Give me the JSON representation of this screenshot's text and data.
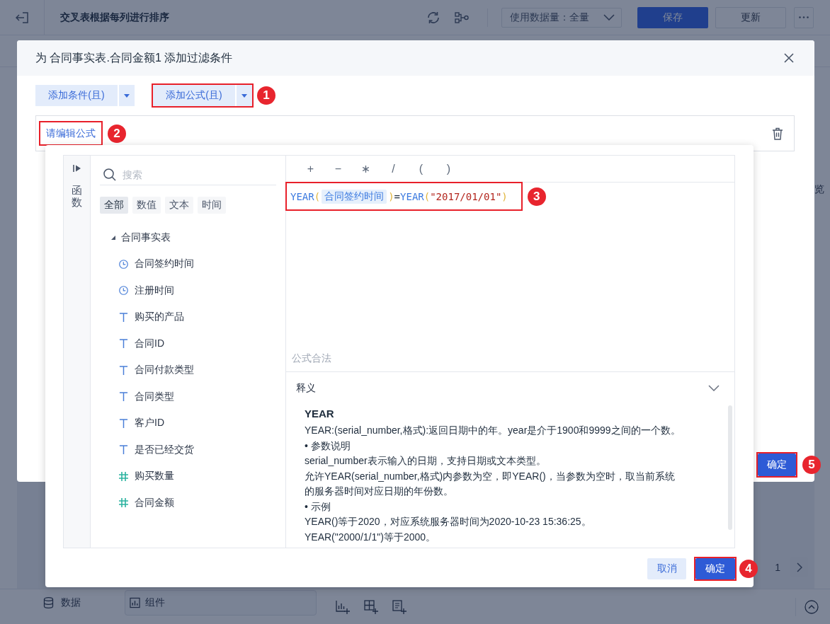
{
  "app": {
    "title": "交叉表根据每列进行排序",
    "data_mode": "使用数据量：全量",
    "actions": [
      {
        "label": "保存",
        "kind": "primary"
      },
      {
        "label": "更新",
        "kind": "default"
      }
    ],
    "side_label": "览",
    "pager": {
      "page": "1"
    },
    "bottom_tabs": [
      {
        "label": "数据",
        "selected": false
      },
      {
        "label": "组件",
        "selected": true
      }
    ]
  },
  "dialog": {
    "title": "为 合同事实表.合同金额1 添加过滤条件",
    "add_buttons": [
      {
        "label": "添加条件(且)"
      },
      {
        "label": "添加公式(且)",
        "callout": "1"
      }
    ],
    "condition": {
      "link": "请编辑公式",
      "callout": "2"
    },
    "confirm": {
      "label": "确定",
      "callout": "5"
    }
  },
  "formula_editor": {
    "rail_label": "函数",
    "search": {
      "placeholder": "搜索"
    },
    "filters": [
      {
        "label": "全部",
        "selected": true
      },
      {
        "label": "数值",
        "selected": false
      },
      {
        "label": "文本",
        "selected": false
      },
      {
        "label": "时间",
        "selected": false
      }
    ],
    "tree": [
      {
        "label": "合同事实表",
        "expanded": true,
        "children": [
          {
            "label": "合同签约时间",
            "kind": "date"
          },
          {
            "label": "注册时间",
            "kind": "date"
          },
          {
            "label": "购买的产品",
            "kind": "text"
          },
          {
            "label": "合同ID",
            "kind": "text"
          },
          {
            "label": "合同付款类型",
            "kind": "text"
          },
          {
            "label": "合同类型",
            "kind": "text"
          },
          {
            "label": "客户ID",
            "kind": "text"
          },
          {
            "label": "是否已经交货",
            "kind": "text"
          },
          {
            "label": "购买数量",
            "kind": "number"
          },
          {
            "label": "合同金额",
            "kind": "number"
          }
        ]
      }
    ],
    "operators": [
      "+",
      "−",
      "∗",
      "/",
      "(",
      ")"
    ],
    "formula": {
      "callout": "3",
      "tokens": [
        {
          "text": "YEAR",
          "kind": "function"
        },
        {
          "text": "(",
          "kind": "paren"
        },
        {
          "text": "合同签约时间",
          "kind": "field"
        },
        {
          "text": ")",
          "kind": "paren"
        },
        {
          "text": "=",
          "kind": "operator"
        },
        {
          "text": "YEAR",
          "kind": "function"
        },
        {
          "text": "(",
          "kind": "paren"
        },
        {
          "text": "\"2017/01/01\"",
          "kind": "string"
        },
        {
          "text": ")",
          "kind": "paren"
        }
      ]
    },
    "status": "公式合法",
    "explanation": {
      "title": "释义",
      "expanded": true,
      "heading": "YEAR",
      "lines": [
        "YEAR:(serial_number,格式):返回日期中的年。year是介于1900和9999之间的一个数。",
        "• 参数说明",
        "serial_number表示输入的日期，支持日期或文本类型。",
        "允许YEAR(serial_number,格式)内参数为空，即YEAR()，当参数为空时，取当前系统",
        "的服务器时间对应日期的年份数。",
        "• 示例",
        "YEAR()等于2020，对应系统服务器时间为2020-10-23 15:36:25。",
        "YEAR(\"2000/1/1\")等于2000。"
      ]
    },
    "buttons": [
      {
        "label": "取消",
        "kind": "secondary"
      },
      {
        "label": "确定",
        "kind": "primary",
        "callout": "4"
      }
    ]
  }
}
